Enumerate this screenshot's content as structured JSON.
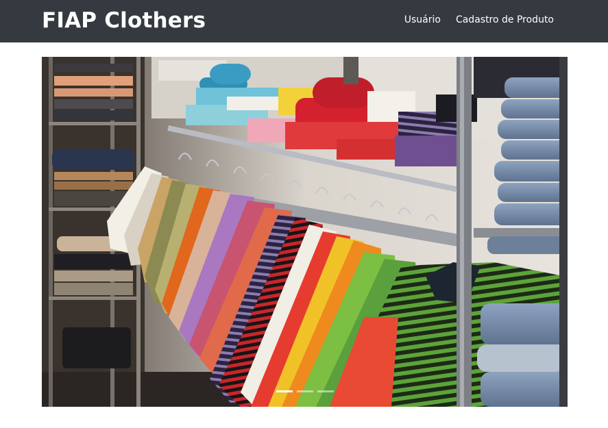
{
  "navbar": {
    "brand": "FIAP Clothers",
    "links": [
      {
        "label": "Usuário"
      },
      {
        "label": "Cadastro de Produto"
      }
    ],
    "background": "#343a40"
  },
  "carousel": {
    "slide_icon": "clothing-store-photo",
    "slide_count": 3,
    "active_index": 0
  }
}
